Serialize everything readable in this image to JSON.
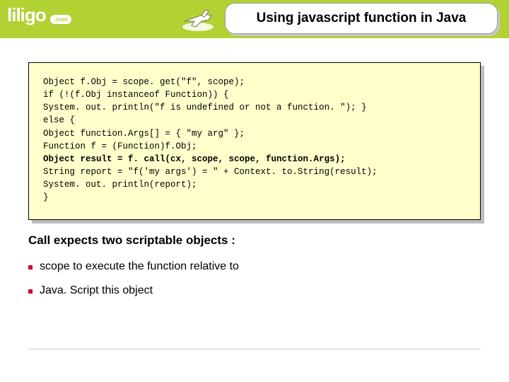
{
  "brand": {
    "name": "liligo",
    "suffix": ".com"
  },
  "title": "Using javascript function in Java",
  "code": {
    "l1": "Object f.Obj = scope. get(\"f\", scope);",
    "l2": "if (!(f.Obj instanceof Function)) {",
    "l3": "System. out. println(\"f is undefined or not a function. \"); }",
    "l4": "else {",
    "l5": "Object function.Args[] = { \"my arg\" };",
    "l6": "Function f = (Function)f.Obj;",
    "l7": "Object result = f. call(cx, scope, scope, function.Args);",
    "l8": "String report = \"f('my args') = \" + Context. to.String(result);",
    "l9": "System. out. println(report);",
    "l10": "}"
  },
  "subheading": "Call expects two  scriptable objects :",
  "bullets": {
    "b1": "scope to execute the function relative to",
    "b2": "Java. Script this object"
  }
}
